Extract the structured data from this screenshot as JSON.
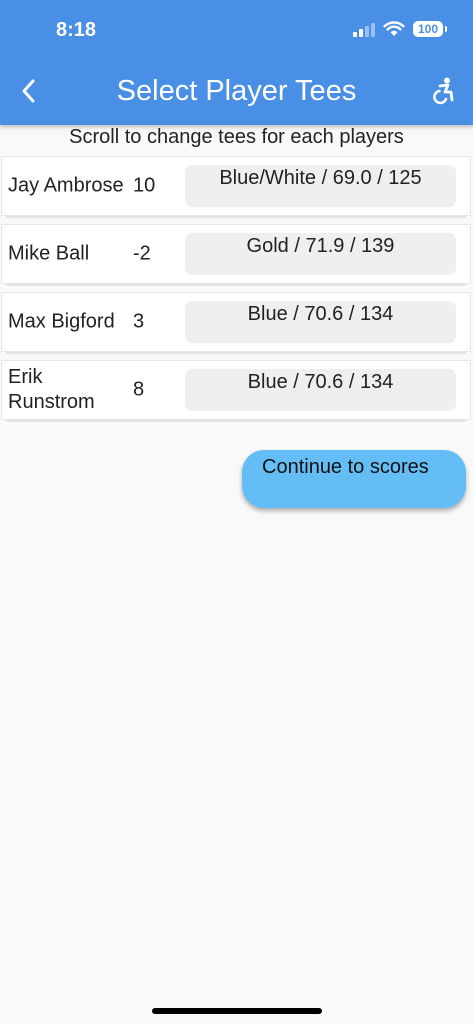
{
  "status_bar": {
    "time": "8:18",
    "battery": "100"
  },
  "app_bar": {
    "title": "Select Player Tees",
    "back_icon": "chevron-left-icon",
    "action_icon": "accessibility-icon"
  },
  "instruction": "Scroll to change tees for each players",
  "players": [
    {
      "name": "Jay Ambrose",
      "handicap": "10",
      "tee": "Blue/White / 69.0 / 125"
    },
    {
      "name": "Mike Ball",
      "handicap": "-2",
      "tee": "Gold / 71.9 / 139"
    },
    {
      "name": "Max Bigford",
      "handicap": "3",
      "tee": "Blue / 70.6 / 134"
    },
    {
      "name": "Erik Runstrom",
      "handicap": "8",
      "tee": "Blue / 70.6 / 134"
    }
  ],
  "continue_label": "Continue to scores",
  "colors": {
    "app_bar": "#4a8fe6",
    "button": "#64bef5",
    "background": "#f9f9f9"
  }
}
